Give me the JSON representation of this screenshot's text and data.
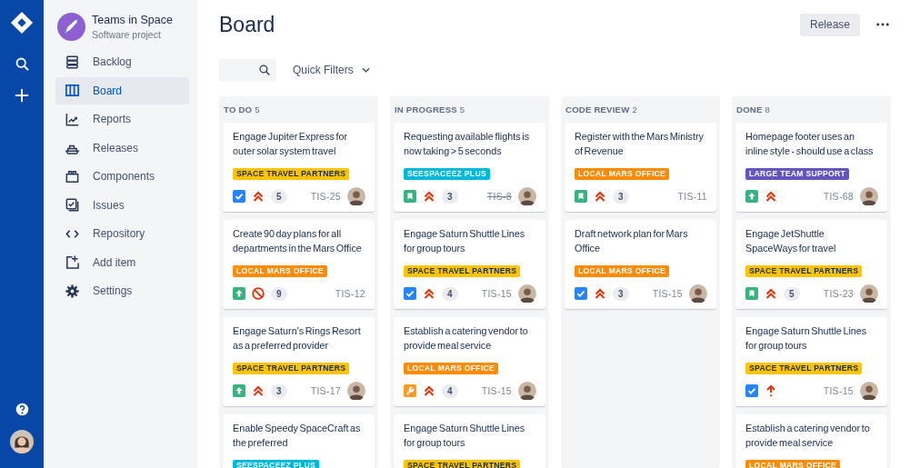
{
  "project": {
    "name": "Teams in Space",
    "type": "Software project"
  },
  "sidebar": {
    "items": [
      {
        "label": "Backlog",
        "kind": "backlog",
        "selected": false
      },
      {
        "label": "Board",
        "kind": "board",
        "selected": true
      },
      {
        "label": "Reports",
        "kind": "reports",
        "selected": false
      },
      {
        "label": "Releases",
        "kind": "releases",
        "selected": false
      },
      {
        "label": "Components",
        "kind": "components",
        "selected": false
      },
      {
        "label": "Issues",
        "kind": "issues",
        "selected": false
      },
      {
        "label": "Repository",
        "kind": "repository",
        "selected": false
      },
      {
        "label": "Add item",
        "kind": "add",
        "selected": false
      },
      {
        "label": "Settings",
        "kind": "settings",
        "selected": false
      }
    ]
  },
  "page": {
    "title": "Board",
    "release_button": "Release"
  },
  "filters": {
    "quick_filters": "Quick Filters"
  },
  "columns": [
    {
      "name": "TO DO",
      "count": "5",
      "cards": [
        {
          "title": "Engage Jupiter Express for outer solar system travel",
          "label": {
            "text": "SPACE TRAVEL PARTNERS",
            "color": "#ffc400"
          },
          "issue_type": {
            "kind": "task"
          },
          "priority": {
            "kind": "highest"
          },
          "points": "5",
          "key": "TIS-25",
          "resolved": false,
          "avatar": true
        },
        {
          "title": "Create 90 day plans for all departments in the Mars Office",
          "label": {
            "text": "LOCAL MARS OFFICE",
            "color": "#ff8b00"
          },
          "issue_type": {
            "kind": "improvement"
          },
          "priority": {
            "kind": "blocker"
          },
          "points": "9",
          "key": "TIS-12",
          "resolved": false,
          "avatar": false
        },
        {
          "title": "Engage Saturn's Rings Resort as a preferred provider",
          "label": {
            "text": "SPACE TRAVEL PARTNERS",
            "color": "#ffc400"
          },
          "issue_type": {
            "kind": "improvement"
          },
          "priority": {
            "kind": "highest"
          },
          "points": "3",
          "key": "TIS-17",
          "resolved": false,
          "avatar": true
        },
        {
          "title": "Enable Speedy SpaceCraft as the preferred",
          "label": {
            "text": "SEESPACEEZ PLUS",
            "color": "#00b8d9"
          }
        }
      ]
    },
    {
      "name": "IN PROGRESS",
      "count": "5",
      "cards": [
        {
          "title": "Requesting available flights is now taking > 5 seconds",
          "label": {
            "text": "SEESPACEEZ PLUS",
            "color": "#00b8d9"
          },
          "issue_type": {
            "kind": "story"
          },
          "priority": {
            "kind": "highest"
          },
          "points": "3",
          "key": "TIS-8",
          "resolved": true,
          "avatar": true
        },
        {
          "title": "Engage Saturn Shuttle Lines for group tours",
          "label": {
            "text": "SPACE TRAVEL PARTNERS",
            "color": "#ffc400"
          },
          "issue_type": {
            "kind": "task"
          },
          "priority": {
            "kind": "highest"
          },
          "points": "4",
          "key": "TIS-15",
          "resolved": false,
          "avatar": true
        },
        {
          "title": "Establish a catering vendor to provide meal service",
          "label": {
            "text": "LOCAL MARS OFFICE",
            "color": "#ff8b00"
          },
          "issue_type": {
            "kind": "subtask"
          },
          "priority": {
            "kind": "highest"
          },
          "points": "4",
          "key": "TIS-15",
          "resolved": false,
          "avatar": true
        },
        {
          "title": "Engage Saturn Shuttle Lines for group tours",
          "label": {
            "text": "SPACE TRAVEL PARTNERS",
            "color": "#ffc400"
          }
        }
      ]
    },
    {
      "name": "CODE REVIEW",
      "count": "2",
      "cards": [
        {
          "title": "Register with the Mars Ministry of Revenue",
          "label": {
            "text": "LOCAL MARS OFFICE",
            "color": "#ff8b00"
          },
          "issue_type": {
            "kind": "story"
          },
          "priority": {
            "kind": "highest"
          },
          "points": "3",
          "key": "TIS-11",
          "resolved": false,
          "avatar": false
        },
        {
          "title": "Draft network plan for Mars Office",
          "label": {
            "text": "LOCAL MARS OFFICE",
            "color": "#ff8b00"
          },
          "issue_type": {
            "kind": "task"
          },
          "priority": {
            "kind": "highest"
          },
          "points": "3",
          "key": "TIS-15",
          "resolved": false,
          "avatar": true
        }
      ]
    },
    {
      "name": "DONE",
      "count": "8",
      "cards": [
        {
          "title": "Homepage footer uses an inline style - should use a class",
          "label": {
            "text": "LARGE TEAM SUPPORT",
            "color": "#6554c0"
          },
          "issue_type": {
            "kind": "improvement"
          },
          "priority": {
            "kind": "highest"
          },
          "key": "TIS-68",
          "resolved": false,
          "avatar": true
        },
        {
          "title": "Engage JetShuttle SpaceWays for travel",
          "label": {
            "text": "SPACE TRAVEL PARTNERS",
            "color": "#ffc400"
          },
          "issue_type": {
            "kind": "story"
          },
          "priority": {
            "kind": "highest"
          },
          "points": "5",
          "key": "TIS-23",
          "resolved": false,
          "avatar": true
        },
        {
          "title": "Engage Saturn Shuttle Lines for group tours",
          "label": {
            "text": "SPACE TRAVEL PARTNERS",
            "color": "#ffc400"
          },
          "issue_type": {
            "kind": "task"
          },
          "priority": {
            "kind": "high"
          },
          "key": "TIS-15",
          "resolved": false,
          "avatar": true
        },
        {
          "title": "Establish a catering vendor to provide meal service",
          "label": {
            "text": "LOCAL MARS OFFICE",
            "color": "#ff8b00"
          }
        }
      ]
    }
  ]
}
